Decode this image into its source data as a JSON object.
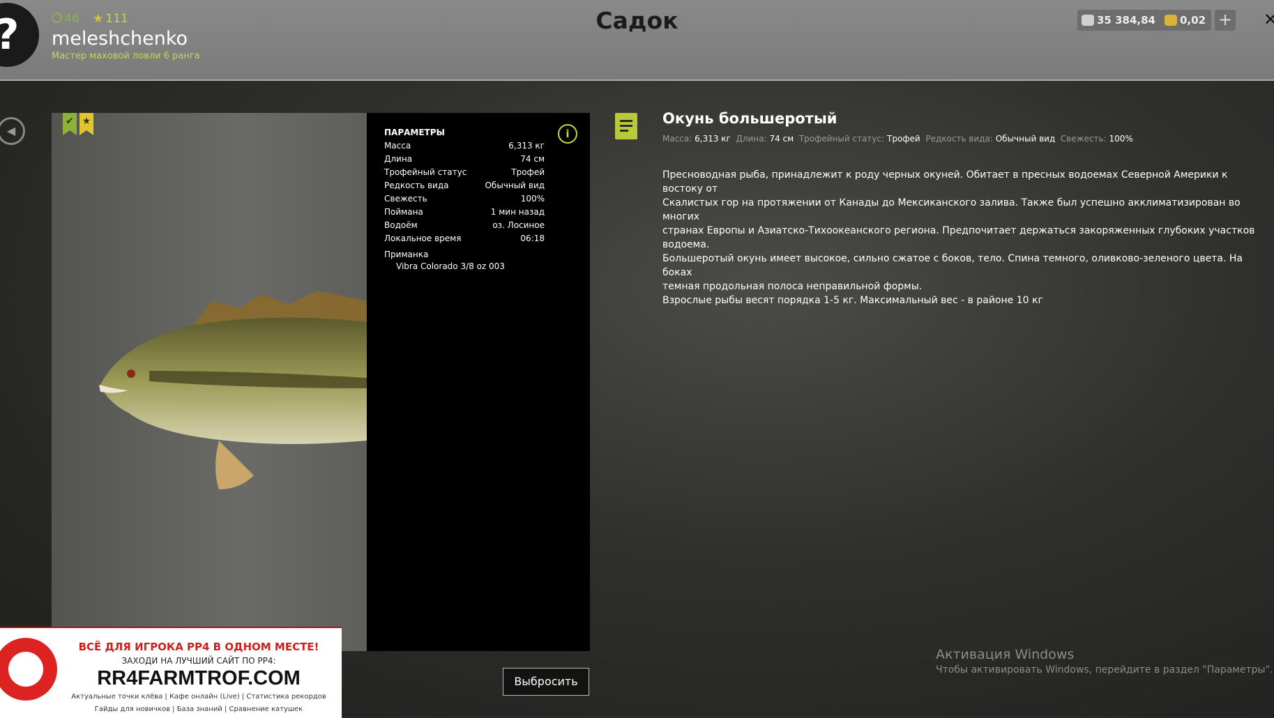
{
  "header": {
    "level": "46",
    "stars": "111",
    "username": "meleshchenko",
    "rank": "Мастер маховой ловли 6 ранга",
    "title": "Садок",
    "silver": "35 384,84",
    "gold": "0,02",
    "plus": "+",
    "close": "✕",
    "avatar": "?"
  },
  "params": {
    "heading": "ПАРАМЕТРЫ",
    "rows": [
      {
        "label": "Масса",
        "value": "6,313 кг"
      },
      {
        "label": "Длина",
        "value": "74 см"
      },
      {
        "label": "Трофейный статус",
        "value": "Трофей"
      },
      {
        "label": "Редкость вида",
        "value": "Обычный вид"
      },
      {
        "label": "Свежесть",
        "value": "100%"
      },
      {
        "label": "Поймана",
        "value": "1 мин назад"
      },
      {
        "label": "Водоём",
        "value": "оз. Лосиное"
      },
      {
        "label": "Локальное время",
        "value": "06:18"
      }
    ],
    "lure_label": "Приманка",
    "lure_value": "Vibra Colorado 3/8 oz 003"
  },
  "fish": {
    "name": "Окунь большеротый",
    "summary": {
      "mass_label": "Масса:",
      "mass": "6,313 кг",
      "length_label": "Длина:",
      "length": "74 см",
      "trophy_label": "Трофейный статус:",
      "trophy": "Трофей",
      "rarity_label": "Редкость вида:",
      "rarity": "Обычный вид",
      "fresh_label": "Свежесть:",
      "fresh": "100%"
    },
    "description": "Пресноводная рыба, принадлежит к роду черных окуней. Обитает в пресных водоемах Северной Америки к востоку от\nСкалистых гор на протяжении от Канады до Мексиканского залива. Также был успешно акклиматизирован во многих\nстранах Европы и Азиатско-Тихоокеанского региона. Предпочитает держаться закоряженных глубоких участков водоема.\nБольшеротый окунь имеет высокое, сильно сжатое с боков, тело. Спина темного, оливково-зеленого цвета. На боках\nтемная продольная полоса неправильной формы.\nВзрослые рыбы весят порядка 1-5 кг. Максимальный вес - в районе 10 кг"
  },
  "buttons": {
    "discard": "Выбросить"
  },
  "windows": {
    "line1": "Активация Windows",
    "line2": "Чтобы активировать Windows, перейдите в раздел \"Параметры\"."
  },
  "ad": {
    "line1": "ВСЁ ДЛЯ ИГРОКА РР4 В ОДНОМ МЕСТЕ!",
    "line2": "ЗАХОДИ НА ЛУЧШИЙ САЙТ ПО РР4:",
    "line3": "RR4FARMTROF.COM",
    "line4": "Актуальные точки клёва  |  Кафе онлайн (Live)  |  Статистика рекордов",
    "line5": "Гайды для новичков  |  База знаний  |  Сравнение катушек"
  },
  "colors": {
    "accent": "#c7d64a",
    "ad_red": "#d21d1d"
  },
  "icons": [
    "xp-circle-icon",
    "star-icon",
    "silver-coins-icon",
    "gold-coins-icon",
    "plus-icon",
    "close-icon",
    "back-arrow-icon",
    "trophy-badge-icon",
    "star-badge-icon",
    "info-icon",
    "note-icon"
  ]
}
